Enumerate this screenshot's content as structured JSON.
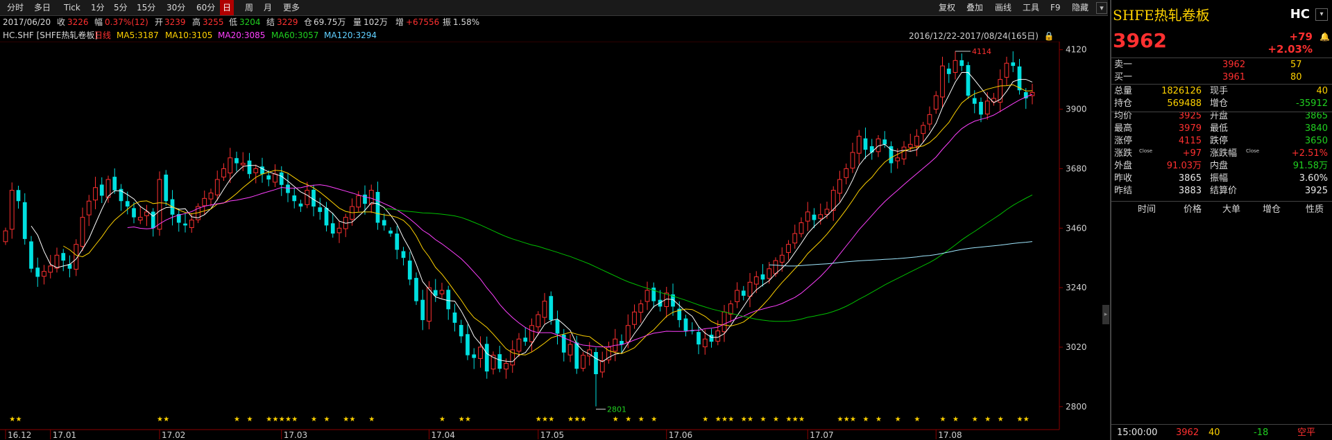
{
  "toolbar": {
    "periods": [
      "分时",
      "多日",
      "Tick",
      "1分",
      "5分",
      "15分",
      "30分",
      "60分",
      "日",
      "周",
      "月",
      "更多"
    ],
    "active_period": "日",
    "right": [
      "复权",
      "叠加",
      "画线",
      "工具",
      "F9",
      "隐藏"
    ]
  },
  "infobar": {
    "date": "2017/06/20",
    "close_label": "收",
    "close": "3226",
    "range_label": "幅",
    "range": "0.37%(12)",
    "open_label": "开",
    "open": "3239",
    "high_label": "高",
    "high": "3255",
    "low_label": "低",
    "low": "3204",
    "settle_label": "结",
    "settle": "3229",
    "oi_label": "仓",
    "oi": "69.75万",
    "vol_label": "量",
    "vol": "102万",
    "inc_label": "增",
    "inc": "+67556",
    "amp_label": "振",
    "amp": "1.58%"
  },
  "mabar": {
    "symbol": "HC.SHF [SHFE热轧卷板]",
    "kind": "日线",
    "ma5": "MA5:3187",
    "ma10": "MA10:3105",
    "ma20": "MA20:3085",
    "ma60": "MA60:3057",
    "ma120": "MA120:3294"
  },
  "range_text": "2016/12/22-2017/08/24(165日)",
  "colors": {
    "up": "#ff3030",
    "down": "#00e0e0",
    "ma5": "#ffffff",
    "ma10": "#ffd200",
    "ma20": "#ff40ff",
    "ma60": "#00c000",
    "ma120": "#a0e8ff"
  },
  "chart_data": {
    "type": "candlestick",
    "y_ticks": [
      4120,
      3900,
      3680,
      3460,
      3240,
      3020,
      2800
    ],
    "ylim": [
      2715,
      4150
    ],
    "x_labels": [
      {
        "i": 0,
        "label": "16.12"
      },
      {
        "i": 7,
        "label": "17.01"
      },
      {
        "i": 24,
        "label": "17.02"
      },
      {
        "i": 43,
        "label": "17.03"
      },
      {
        "i": 66,
        "label": "17.04"
      },
      {
        "i": 83,
        "label": "17.05"
      },
      {
        "i": 103,
        "label": "17.06"
      },
      {
        "i": 125,
        "label": "17.07"
      },
      {
        "i": 145,
        "label": "17.08"
      }
    ],
    "max_annotation": "4114",
    "min_annotation": "2801",
    "star_indices": [
      1,
      2,
      24,
      25,
      36,
      38,
      41,
      42,
      43,
      44,
      45,
      48,
      50,
      53,
      54,
      57,
      68,
      71,
      72,
      83,
      84,
      85,
      88,
      89,
      90,
      95,
      97,
      99,
      101,
      109,
      111,
      112,
      113,
      115,
      116,
      118,
      120,
      122,
      123,
      124,
      130,
      131,
      132,
      134,
      136,
      139,
      142,
      146,
      148,
      151,
      153,
      155,
      158,
      159
    ],
    "close": [
      3450,
      3600,
      3560,
      3420,
      3310,
      3280,
      3300,
      3320,
      3360,
      3340,
      3310,
      3400,
      3500,
      3560,
      3610,
      3580,
      3640,
      3600,
      3560,
      3540,
      3500,
      3500,
      3520,
      3460,
      3640,
      3560,
      3510,
      3480,
      3470,
      3490,
      3540,
      3570,
      3590,
      3640,
      3680,
      3720,
      3700,
      3700,
      3660,
      3680,
      3660,
      3640,
      3660,
      3620,
      3590,
      3560,
      3540,
      3600,
      3540,
      3520,
      3470,
      3440,
      3460,
      3500,
      3540,
      3580,
      3550,
      3600,
      3480,
      3470,
      3440,
      3380,
      3350,
      3270,
      3190,
      3120,
      3240,
      3210,
      3230,
      3160,
      3110,
      3060,
      2990,
      2980,
      3020,
      2930,
      2990,
      2940,
      2960,
      3010,
      3050,
      3040,
      3100,
      3140,
      3190,
      3120,
      3070,
      3000,
      3030,
      2940,
      2990,
      3010,
      2920,
      2970,
      3020,
      3050,
      3030,
      3100,
      3150,
      3180,
      3230,
      3190,
      3170,
      3220,
      3170,
      3120,
      3080,
      3080,
      3030,
      3050,
      3040,
      3080,
      3150,
      3180,
      3230,
      3210,
      3260,
      3280,
      3270,
      3310,
      3340,
      3360,
      3400,
      3440,
      3480,
      3520,
      3490,
      3510,
      3530,
      3600,
      3640,
      3680,
      3740,
      3800,
      3750,
      3740,
      3790,
      3770,
      3700,
      3720,
      3760,
      3770,
      3800,
      3840,
      3880,
      3950,
      4060,
      4030,
      4080,
      4060,
      3950,
      3920,
      3880,
      3930,
      3940,
      4010,
      4070,
      4060,
      3970,
      3940,
      3962
    ]
  },
  "right_panel": {
    "title": "SHFE热轧卷板",
    "code": "HC",
    "price": "3962",
    "change": "+79",
    "change_pct": "+2.03%",
    "ask_label": "卖一",
    "ask_price": "3962",
    "ask_vol": "57",
    "bid_label": "买一",
    "bid_price": "3961",
    "bid_vol": "80",
    "stats": [
      {
        "l1": "总量",
        "v1": "1826126",
        "c1": "yellow",
        "l2": "现手",
        "v2": "40",
        "c2": "yellow"
      },
      {
        "l1": "持仓",
        "v1": "569488",
        "c1": "yellow",
        "l2": "增仓",
        "v2": "-35912",
        "c2": "green"
      },
      {
        "l1": "均价",
        "v1": "3925",
        "c1": "red",
        "l2": "开盘",
        "v2": "3865",
        "c2": "green"
      },
      {
        "l1": "最高",
        "v1": "3979",
        "c1": "red",
        "l2": "最低",
        "v2": "3840",
        "c2": "green"
      },
      {
        "l1": "涨停",
        "v1": "4115",
        "c1": "red",
        "l2": "跌停",
        "v2": "3650",
        "c2": "green"
      },
      {
        "l1": "涨跌",
        "v1": "+97",
        "c1": "red",
        "l2": "涨跌幅",
        "v2": "+2.51%",
        "c2": "red",
        "sup": "Close"
      },
      {
        "l1": "外盘",
        "v1": "91.03万",
        "c1": "red",
        "l2": "内盘",
        "v2": "91.58万",
        "c2": "green"
      },
      {
        "l1": "昨收",
        "v1": "3865",
        "c1": "white",
        "l2": "振幅",
        "v2": "3.60%",
        "c2": "white"
      },
      {
        "l1": "昨结",
        "v1": "3883",
        "c1": "white",
        "l2": "结算价",
        "v2": "3925",
        "c2": "white"
      }
    ],
    "tick_headers": [
      "时间",
      "价格",
      "大单",
      "增仓",
      "性质"
    ],
    "last_tick": {
      "time": "15:00:00",
      "price": "3962",
      "vol": "40",
      "inc": "-18",
      "kind": "空平"
    }
  }
}
